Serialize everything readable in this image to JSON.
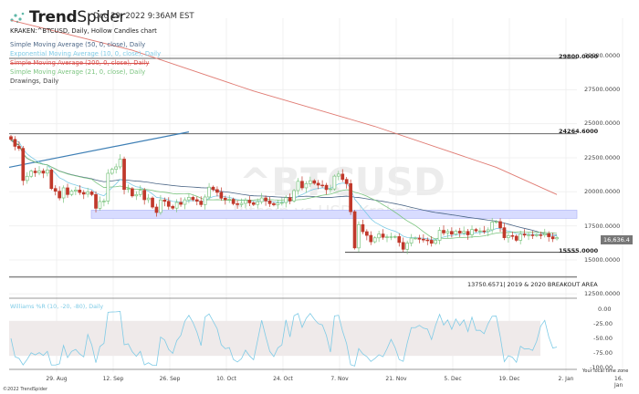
{
  "header": {
    "brand_bold": "Trend",
    "brand_light": "Spider",
    "date": "Dec 29, 2022 9:36AM EST"
  },
  "legend": {
    "title": "KRAKEN:^BTCUSD, Daily, Hollow Candles chart",
    "items": [
      {
        "label": "Simple Moving Average (50, 0, close), Daily",
        "color": "#4a6585"
      },
      {
        "label": "Exponential Moving Average (10, 0, close), Daily",
        "color": "#7fcbe6"
      },
      {
        "label": "Simple Moving Average (200, 0, close), Daily",
        "color": "#d9534f"
      },
      {
        "label": "Simple Moving Average (21, 0, close), Daily",
        "color": "#7bc47f"
      },
      {
        "label": "Drawings, Daily",
        "color": "#444444"
      }
    ]
  },
  "watermark": {
    "symbol": "^BTCUSD",
    "name": "Bitcoin vs USD Kraken"
  },
  "levels": [
    {
      "value": 29800,
      "label": "29800.0000"
    },
    {
      "value": 24264.6,
      "label": "24264.6000"
    },
    {
      "value": 15555,
      "label": "15555.0000"
    },
    {
      "value": 13750.6571,
      "label": "13750.6571| 2019 & 2020 BREAKOUT AREA"
    }
  ],
  "y_axis": [
    "30000.0000",
    "27500.0000",
    "25000.0000",
    "22500.0000",
    "20000.0000",
    "17500.0000",
    "15000.0000",
    "12500.0000"
  ],
  "last_price": "16,636.4",
  "wr": {
    "label": "Williams %R (10, -20, -80), Daily",
    "ticks": [
      "0.00",
      "-25.00",
      "-50.00",
      "-75.00",
      "-100.00"
    ]
  },
  "x_axis": [
    "29. Aug",
    "12. Sep",
    "26. Sep",
    "10. Oct",
    "24. Oct",
    "7. Nov",
    "21. Nov",
    "5. Dec",
    "19. Dec",
    "2. Jan",
    "16. Jan"
  ],
  "timezone": "Your local time zone",
  "copyright": "©2022 TrendSpider",
  "chart_data": {
    "type": "candlestick",
    "start": "2022-08-16",
    "closes": [
      23850,
      23340,
      23190,
      20830,
      21140,
      21520,
      21400,
      21530,
      21370,
      21600,
      20240,
      20040,
      19550,
      20290,
      19800,
      20050,
      20130,
      19950,
      19830,
      19990,
      19800,
      18790,
      19290,
      19320,
      21360,
      21650,
      21830,
      22400,
      20170,
      20230,
      19700,
      19800,
      20110,
      19420,
      19540,
      18880,
      18480,
      19400,
      19300,
      18930,
      18800,
      19220,
      19080,
      19410,
      19590,
      19420,
      19310,
      19060,
      19620,
      20340,
      20160,
      19960,
      19530,
      19420,
      19450,
      19130,
      19060,
      19150,
      19380,
      19190,
      19070,
      19270,
      19550,
      19330,
      19130,
      19050,
      19170,
      19210,
      19570,
      19330,
      20090,
      20770,
      20290,
      20600,
      20810,
      20630,
      20490,
      20480,
      20160,
      20210,
      21150,
      21300,
      20910,
      20600,
      18540,
      15880,
      17590,
      17070,
      16800,
      16330,
      16620,
      16900,
      16660,
      16690,
      16700,
      16710,
      16280,
      15780,
      16230,
      16600,
      16600,
      16520,
      16460,
      16440,
      16220,
      16440,
      17170,
      16980,
      17090,
      16890,
      17110,
      16970,
      17090,
      16840,
      17230,
      17130,
      17130,
      17090,
      17210,
      17780,
      17810,
      17360,
      16630,
      16780,
      16740,
      16440,
      16900,
      16820,
      16830,
      16780,
      16840,
      16830,
      16920,
      16700,
      16550,
      16636
    ],
    "sma200": [
      [
        0,
        32600
      ],
      [
        30,
        30400
      ],
      [
        60,
        27400
      ],
      [
        90,
        24800
      ],
      [
        120,
        21800
      ],
      [
        135,
        19800
      ]
    ],
    "trendline": [
      [
        0,
        21800
      ],
      [
        44,
        24400
      ]
    ],
    "zone": [
      18050,
      18650
    ],
    "ylim": [
      12000,
      31000
    ]
  },
  "colors": {
    "up": "#7bc47f",
    "down": "#c0392b"
  }
}
